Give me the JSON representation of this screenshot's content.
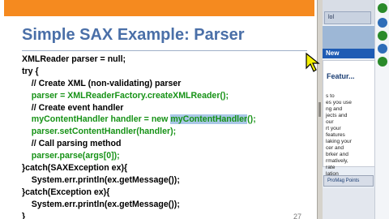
{
  "slide": {
    "title": "Simple SAX Example: Parser",
    "slide_number": "27",
    "code_lines": [
      [
        {
          "t": "XMLReader parser = null;",
          "s": "k"
        }
      ],
      [
        {
          "t": "try {",
          "s": "k"
        }
      ],
      [
        {
          "t": "    // Create XML (non-validating) parser",
          "s": "c"
        }
      ],
      [
        {
          "t": "    parser = XMLReaderFactory.createXMLReader();",
          "s": "g"
        }
      ],
      [
        {
          "t": "    // Create event handler",
          "s": "c"
        }
      ],
      [
        {
          "t": "    myContentHandler handler = new ",
          "s": "g"
        },
        {
          "t": "myContentHandler",
          "s": "h"
        },
        {
          "t": "();",
          "s": "g"
        }
      ],
      [
        {
          "t": "    parser.setContentHandler(handler);",
          "s": "g"
        }
      ],
      [
        {
          "t": "    // Call parsing method",
          "s": "c"
        }
      ],
      [
        {
          "t": "    parser.parse(args[0]);",
          "s": "g"
        }
      ],
      [
        {
          "t": "}catch(SAXException ex){",
          "s": "k"
        }
      ],
      [
        {
          "t": "    System.err.println(ex.getMessage());",
          "s": "k"
        }
      ],
      [
        {
          "t": "}catch(Exception ex){",
          "s": "k"
        }
      ],
      [
        {
          "t": "    System.err.println(ex.getMessage());",
          "s": "k"
        }
      ],
      [
        {
          "t": "}",
          "s": "k"
        }
      ]
    ]
  },
  "side_panel": {
    "tab_label": "lol",
    "new_label": "New",
    "card_heading": "Featur...",
    "card_text": "s to\nes you use\nng and\njects and\nour\nrt your\nfeatures\nlaking your\ncer and\nbrker and\nrmatively,\nrate\nlation",
    "button_label": "ProMag Points",
    "colors": {
      "accent_green": "#2a8a2a",
      "accent_blue": "#2e6db8",
      "header_blue": "#1e5bb4"
    }
  },
  "colors": {
    "title": "#4a6fa8",
    "orange_bar": "#f58a1f",
    "code_green": "#169216",
    "highlight": "#a9c7e6"
  },
  "icons": [
    "cursor-pointer-icon"
  ]
}
